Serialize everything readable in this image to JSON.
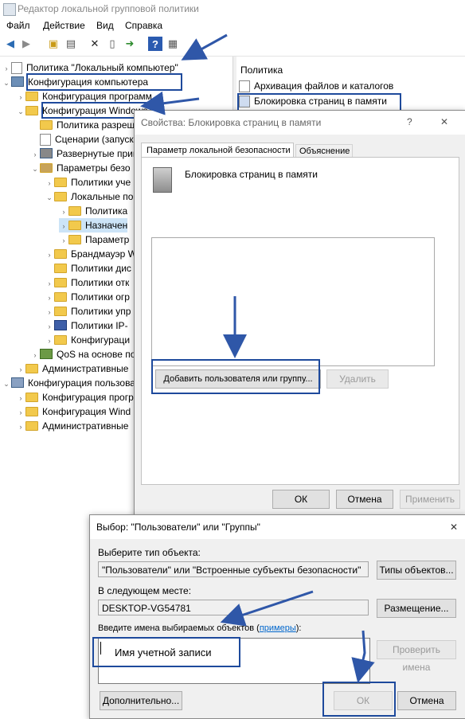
{
  "window": {
    "title": "Редактор локальной групповой политики"
  },
  "menu": [
    "Файл",
    "Действие",
    "Вид",
    "Справка"
  ],
  "tree": [
    "Политика \"Локальный компьютер\"",
    "Конфигурация компьютера",
    "Конфигурация программ",
    "Конфигурация Windows",
    "Политика разреш",
    "Сценарии (запуск",
    "Развернутые прин",
    "Параметры безо",
    "Политики уче",
    "Локальные по",
    "Политика",
    "Назначен",
    "Параметр",
    "Брандмауэр W",
    "Политики дис",
    "Политики отк",
    "Политики огр",
    "Политики упр",
    "Политики IP-",
    "Конфигураци",
    "QoS на основе пол",
    "Административные",
    "Конфигурация пользова",
    "Конфигурация прогр",
    "Конфигурация Wind",
    "Административные"
  ],
  "right_pane": {
    "header": "Политика",
    "items": [
      "Архивация файлов и каталогов",
      "Блокировка страниц в памяти"
    ]
  },
  "properties_dialog": {
    "title": "Свойства: Блокировка страниц в памяти",
    "help": "?",
    "close": "✕",
    "tabs": [
      "Параметр локальной безопасности",
      "Объяснение"
    ],
    "policy_name": "Блокировка страниц в памяти",
    "add_button": "Добавить пользователя или группу...",
    "remove_button": "Удалить",
    "ok": "ОК",
    "cancel": "Отмена",
    "apply": "Применить"
  },
  "select_dialog": {
    "title": "Выбор: \"Пользователи\" или \"Группы\"",
    "close": "✕",
    "object_type_label": "Выберите тип объекта:",
    "object_type_value": "\"Пользователи\" или \"Встроенные субъекты безопасности\"",
    "object_types_button": "Типы объектов...",
    "location_label": "В следующем месте:",
    "location_value": "DESKTOP-VG54781",
    "locations_button": "Размещение...",
    "names_label_prefix": "Введите имена выбираемых объектов (",
    "names_label_link": "примеры",
    "names_label_suffix": "):",
    "names_value": "Имя учетной записи",
    "check_names_button": "Проверить имена",
    "advanced_button": "Дополнительно...",
    "ok": "ОК",
    "cancel": "Отмена"
  },
  "colors": {
    "highlight": "#1e4a9c",
    "arrow": "#2f57a8",
    "dialog_bg": "#f0f0f0"
  }
}
